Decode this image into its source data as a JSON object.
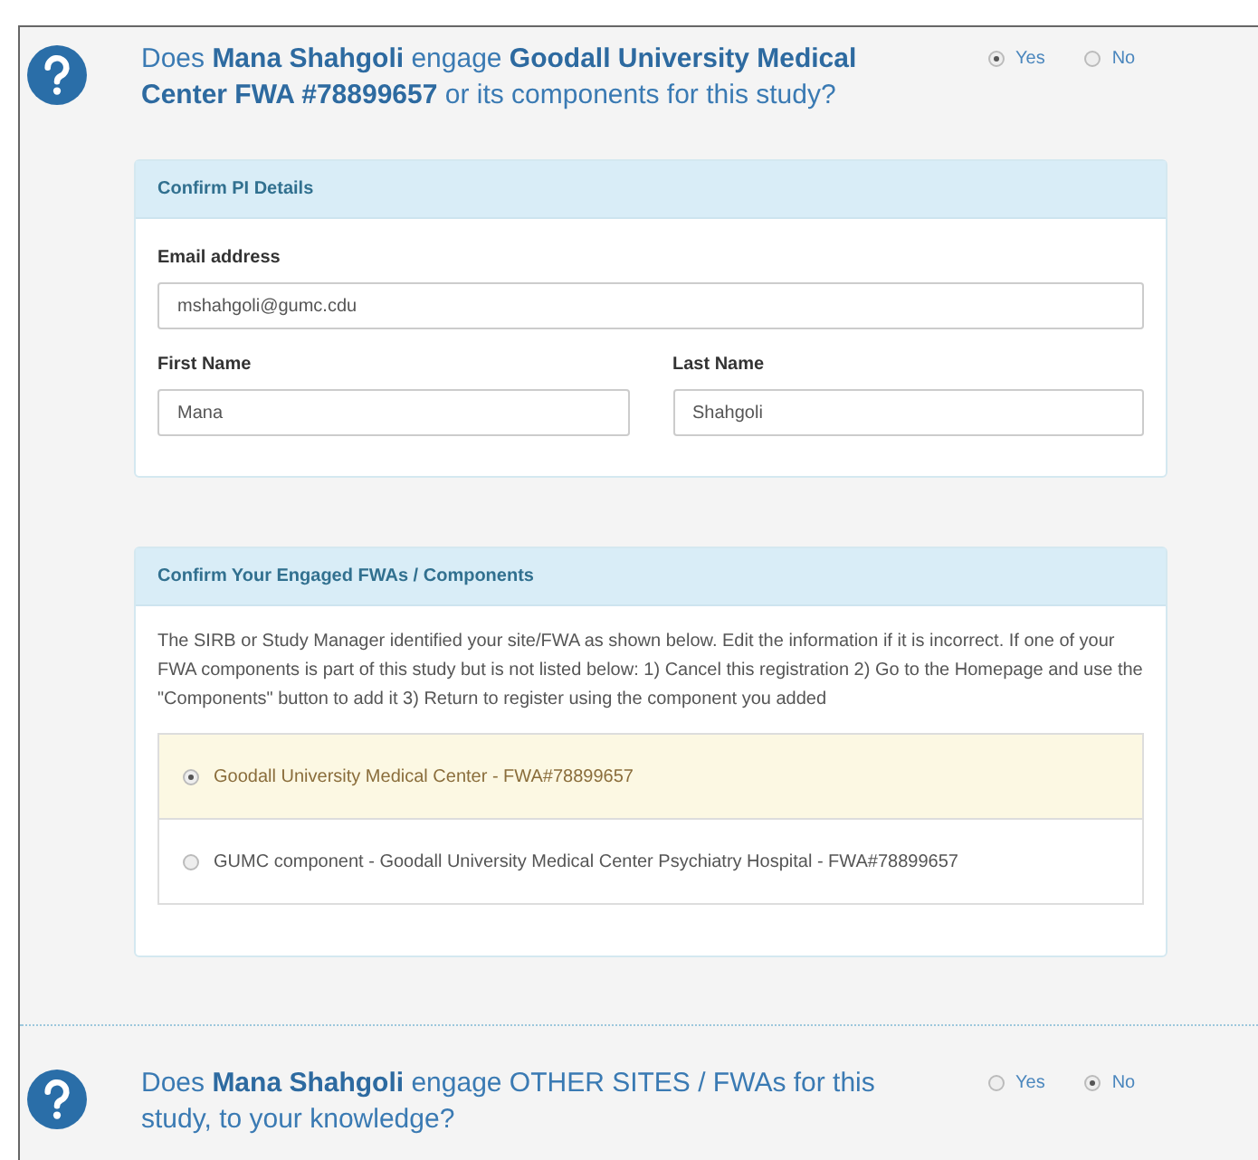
{
  "questions": [
    {
      "text": "Does **Mana Shahgoli** engage **Goodall University Medical Center FWA #78899657** or its components for this study?",
      "options": [
        {
          "label": "Yes",
          "selected": true
        },
        {
          "label": "No",
          "selected": false
        }
      ]
    },
    {
      "text": "Does **Mana Shahgoli** engage OTHER SITES / FWAs for this study, to your knowledge?",
      "options": [
        {
          "label": "Yes",
          "selected": false
        },
        {
          "label": "No",
          "selected": true
        }
      ]
    }
  ],
  "pi_panel": {
    "title": "Confirm PI Details",
    "email_label": "Email address",
    "email_value": "mshahgoli@gumc.cdu",
    "first_label": "First Name",
    "first_value": "Mana",
    "last_label": "Last Name",
    "last_value": "Shahgoli"
  },
  "fwa_panel": {
    "title": "Confirm Your Engaged FWAs / Components",
    "description": "The SIRB or Study Manager identified your site/FWA as shown below. Edit the information if it is incorrect. If one of your FWA components is part of this study but is not listed below: 1) Cancel this registration 2) Go to the Homepage and use the \"Components\" button to add it 3) Return to register using the component you added",
    "options": [
      {
        "label": "Goodall University Medical Center - FWA#78899657",
        "selected": true
      },
      {
        "label": "GUMC component - Goodall University Medical Center Psychiatry Hospital - FWA#78899657",
        "selected": false
      }
    ]
  }
}
